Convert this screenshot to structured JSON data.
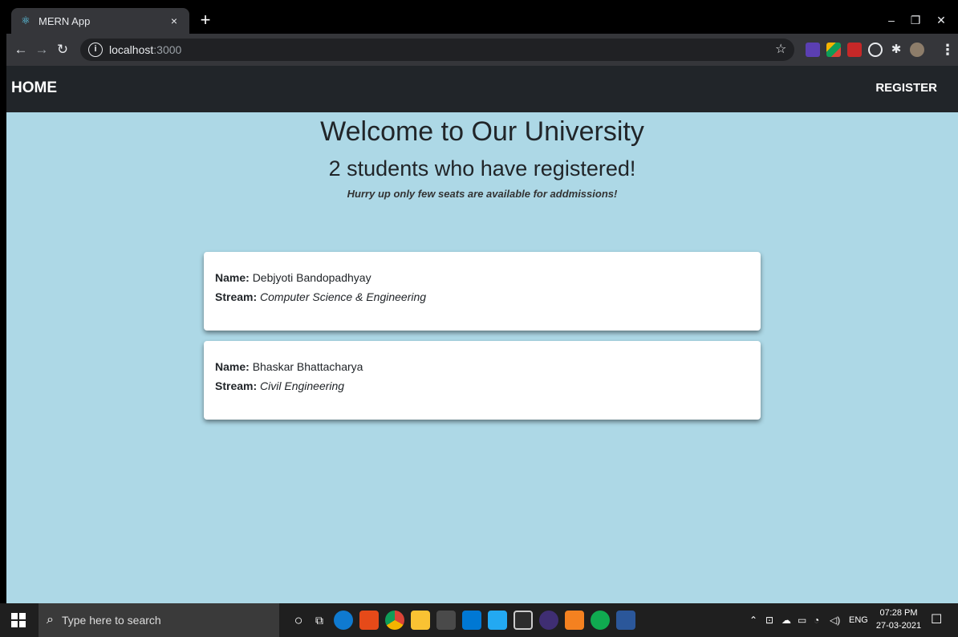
{
  "browser": {
    "tab_title": "MERN App",
    "tab_close": "×",
    "new_tab": "+",
    "url_host": "localhost",
    "url_port": ":3000"
  },
  "navbar": {
    "home_label": "HOME",
    "register_label": "REGISTER"
  },
  "hero": {
    "title": "Welcome to Our University",
    "subtitle": "2 students who have registered!",
    "note": "Hurry up only few seats are available for addmissions!"
  },
  "labels": {
    "name": "Name:",
    "stream": "Stream:"
  },
  "students": [
    {
      "name": "Debjyoti Bandopadhyay",
      "stream": "Computer Science & Engineering"
    },
    {
      "name": "Bhaskar Bhattacharya",
      "stream": "Civil Engineering"
    }
  ],
  "taskbar": {
    "search_placeholder": "Type here to search",
    "language": "ENG",
    "time": "07:28 PM",
    "date": "27-03-2021"
  },
  "colors": {
    "page_bg": "#add8e6",
    "navbar_bg": "#212529",
    "card_bg": "#ffffff"
  }
}
